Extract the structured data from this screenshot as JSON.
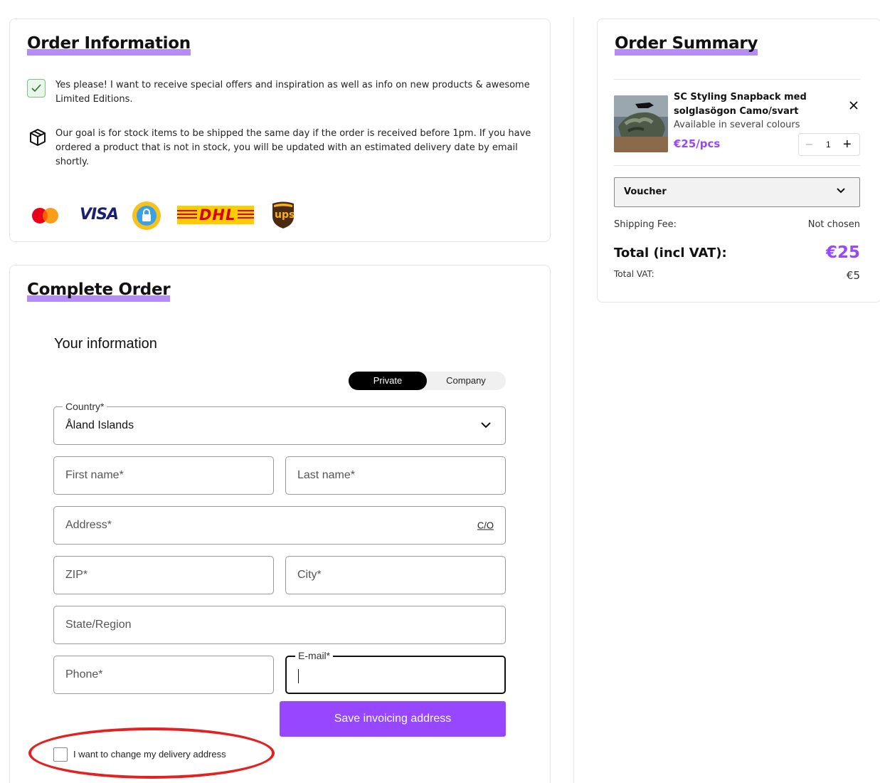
{
  "order_info": {
    "title": "Order Information",
    "newsletter_text": "Yes please! I want to receive special offers and inspiration as well as info on new products & awesome Limited Editions.",
    "newsletter_checked": true,
    "shipping_text": "Our goal is for stock items to be shipped the same day if the order is received before 1pm. If you have ordered a product that is not in stock, you will be updated with an estimated delivery date by email shortly.",
    "payment_logos": [
      "mastercard-icon",
      "visa-icon",
      "trygg-e-handel-icon",
      "dhl-icon",
      "ups-icon"
    ],
    "visa_text": "VISA",
    "dhl_text": "DHL",
    "ups_text": "ups"
  },
  "complete_order": {
    "title": "Complete Order",
    "subtitle": "Your information",
    "toggle": {
      "private": "Private",
      "company": "Company",
      "selected": "Private"
    },
    "country": {
      "label": "Country*",
      "value": "Åland Islands"
    },
    "first_name": {
      "placeholder": "First name*"
    },
    "last_name": {
      "placeholder": "Last name*"
    },
    "address": {
      "placeholder": "Address*",
      "co_link": "C/O"
    },
    "zip": {
      "placeholder": "ZIP*"
    },
    "city": {
      "placeholder": "City*"
    },
    "state": {
      "placeholder": "State/Region"
    },
    "phone": {
      "placeholder": "Phone*"
    },
    "email": {
      "label": "E-mail*",
      "value": ""
    },
    "save_button": "Save invoicing address",
    "delivery_checkbox_label": "I want to change my delivery address",
    "delivery_checked": false
  },
  "order_summary": {
    "title": "Order Summary",
    "product": {
      "name": "SC Styling Snapback med solglasögon Camo/svart",
      "subtitle": "Available in several colours",
      "price": "€25/pcs",
      "quantity": "1"
    },
    "voucher_label": "Voucher",
    "shipping_label": "Shipping Fee:",
    "shipping_value": "Not chosen",
    "total_label": "Total (incl VAT):",
    "total_value": "€25",
    "vat_label": "Total VAT:",
    "vat_value": "€5"
  },
  "colors": {
    "accent": "#9747ff",
    "highlight": "#b58cf6",
    "annotation": "#e52020"
  }
}
